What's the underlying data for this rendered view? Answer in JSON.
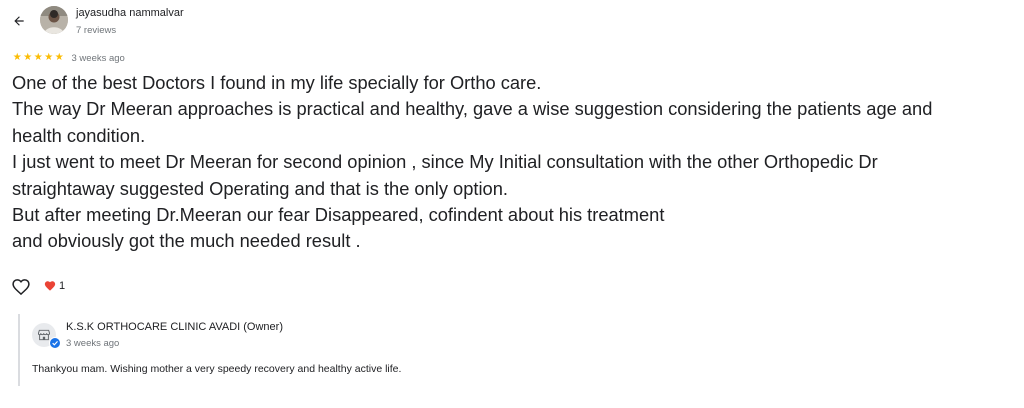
{
  "reviewer": {
    "name": "jayasudha nammalvar",
    "review_count": "7 reviews"
  },
  "rating": {
    "stars": 5,
    "star_glyph": "★",
    "date": "3 weeks ago"
  },
  "review": {
    "lines": [
      "One of the best Doctors  I found in my life specially for Ortho care.",
      "The way Dr Meeran approaches is practical and healthy, gave a wise suggestion considering the patients age and",
      "health condition.",
      "I just went to meet Dr Meeran for second opinion , since My Initial consultation with  the other Orthopedic Dr",
      "straightaway suggested Operating  and that is the only option.",
      "But after meeting Dr.Meeran our fear Disappeared, cofindent about his treatment",
      "and obviously got the much needed result ."
    ]
  },
  "reactions": {
    "like_icon": "heart-outline-icon",
    "heart_icon": "heart-filled-icon",
    "count": "1"
  },
  "owner_reply": {
    "name": "K.S.K ORTHOCARE CLINIC AVADI (Owner)",
    "date": "3 weeks ago",
    "text": "Thankyou mam. Wishing  mother a very speedy recovery and healthy active life."
  },
  "colors": {
    "star": "#fbbc04",
    "heart": "#ea4335",
    "verified": "#1a73e8",
    "secondary_text": "#70757a"
  }
}
